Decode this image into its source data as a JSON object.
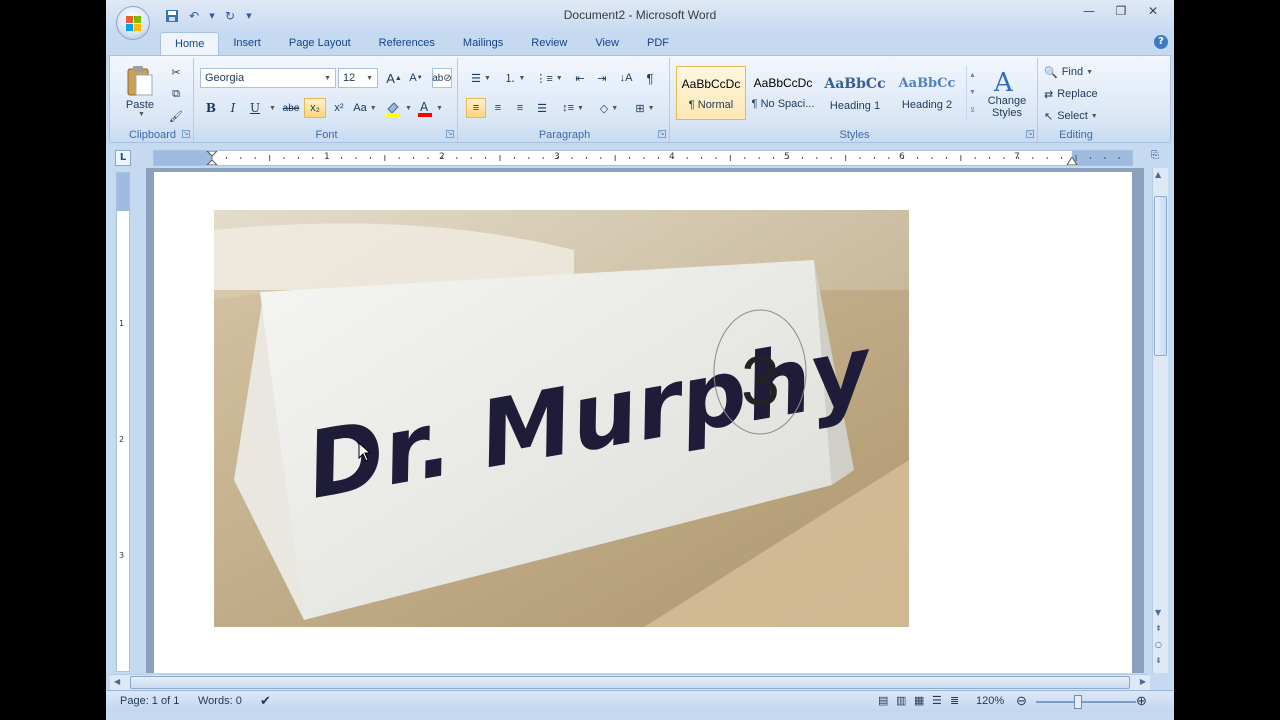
{
  "window": {
    "title": "Document2 - Microsoft Word"
  },
  "quick_access": {
    "save": "save",
    "undo": "undo",
    "redo": "redo"
  },
  "tabs": [
    {
      "label": "Home"
    },
    {
      "label": "Insert"
    },
    {
      "label": "Page Layout"
    },
    {
      "label": "References"
    },
    {
      "label": "Mailings"
    },
    {
      "label": "Review"
    },
    {
      "label": "View"
    },
    {
      "label": "PDF"
    }
  ],
  "clipboard": {
    "paste_label": "Paste",
    "group_label": "Clipboard"
  },
  "font": {
    "family": "Georgia",
    "size": "12",
    "group_label": "Font",
    "bold": "B",
    "italic": "I",
    "underline": "U",
    "strikethrough": "abe",
    "subscript": "x₂",
    "superscript": "x²",
    "change_case": "Aa"
  },
  "paragraph": {
    "group_label": "Paragraph"
  },
  "styles": {
    "group_label": "Styles",
    "items": [
      {
        "sample": "AaBbCcDc",
        "name": "¶ Normal"
      },
      {
        "sample": "AaBbCcDc",
        "name": "¶ No Spaci..."
      },
      {
        "sample": "AaBbCc",
        "name": "Heading 1"
      },
      {
        "sample": "AaBbCc",
        "name": "Heading 2"
      }
    ],
    "change_styles": "Change Styles"
  },
  "editing": {
    "group_label": "Editing",
    "find": "Find",
    "replace": "Replace",
    "select": "Select"
  },
  "ruler": {
    "tab_stop": "L",
    "numbers": [
      "1",
      "2",
      "3",
      "4",
      "5",
      "6",
      "7"
    ]
  },
  "vruler": {
    "numbers": [
      "1",
      "2",
      "3"
    ]
  },
  "document": {
    "photo_name_card": "Dr. Murphy",
    "photo_number": "3"
  },
  "status": {
    "page": "Page: 1 of 1",
    "words": "Words: 0",
    "zoom": "120%"
  },
  "colors": {
    "accent": "#15428b",
    "highlight": "#ffff00",
    "font_color": "#ff0000"
  }
}
